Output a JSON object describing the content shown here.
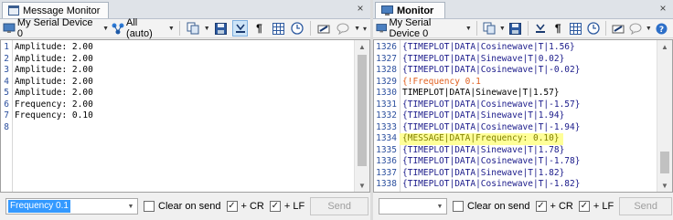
{
  "left": {
    "tab_title": "Message Monitor",
    "device": "My Serial Device 0",
    "filter": "All (auto)",
    "lines": [
      {
        "n": "1",
        "text": "Amplitude: 2.00"
      },
      {
        "n": "2",
        "text": "Amplitude: 2.00"
      },
      {
        "n": "3",
        "text": "Amplitude: 2.00"
      },
      {
        "n": "4",
        "text": "Amplitude: 2.00"
      },
      {
        "n": "5",
        "text": "Amplitude: 2.00"
      },
      {
        "n": "6",
        "text": "Frequency: 2.00"
      },
      {
        "n": "7",
        "text": "Frequency: 0.10"
      },
      {
        "n": "8",
        "text": ""
      }
    ],
    "send_input": "Frequency 0.1",
    "clear_on_send": "Clear on send",
    "cr": "+ CR",
    "lf": "+ LF",
    "send": "Send"
  },
  "right": {
    "tab_title": "Monitor",
    "device": "My Serial Device 0",
    "lines": [
      {
        "n": "1326",
        "text": "{TIMEPLOT|DATA|Cosinewave|T|1.56}",
        "color": "#1a1a8a"
      },
      {
        "n": "1327",
        "text": "{TIMEPLOT|DATA|Sinewave|T|0.02}",
        "color": "#1a1a8a"
      },
      {
        "n": "1328",
        "text": "{TIMEPLOT|DATA|Cosinewave|T|-0.02}",
        "color": "#1a1a8a"
      },
      {
        "n": "1329",
        "text": "{!Frequency 0.1",
        "color": "#e06020"
      },
      {
        "n": "1330",
        "text": "TIMEPLOT|DATA|Sinewave|T|1.57}",
        "color": "#000000"
      },
      {
        "n": "1331",
        "text": "{TIMEPLOT|DATA|Cosinewave|T|-1.57}",
        "color": "#1a1a8a"
      },
      {
        "n": "1332",
        "text": "{TIMEPLOT|DATA|Sinewave|T|1.94}",
        "color": "#1a1a8a"
      },
      {
        "n": "1333",
        "text": "{TIMEPLOT|DATA|Cosinewave|T|-1.94}",
        "color": "#1a1a8a"
      },
      {
        "n": "1334",
        "text": "{MESSAGE|DATA|Frequency: 0.10}",
        "color": "#808000",
        "highlight": "#ffff99"
      },
      {
        "n": "1335",
        "text": "{TIMEPLOT|DATA|Sinewave|T|1.78}",
        "color": "#1a1a8a"
      },
      {
        "n": "1336",
        "text": "{TIMEPLOT|DATA|Cosinewave|T|-1.78}",
        "color": "#1a1a8a"
      },
      {
        "n": "1337",
        "text": "{TIMEPLOT|DATA|Sinewave|T|1.82}",
        "color": "#1a1a8a"
      },
      {
        "n": "1338",
        "text": "{TIMEPLOT|DATA|Cosinewave|T|-1.82}",
        "color": "#1a1a8a"
      }
    ],
    "send_input": "",
    "clear_on_send": "Clear on send",
    "cr": "+ CR",
    "lf": "+ LF",
    "send": "Send"
  },
  "colors": {
    "active_button": "#cde4f7",
    "line_number": "#2b4f9e",
    "selection": "#3399ff"
  }
}
